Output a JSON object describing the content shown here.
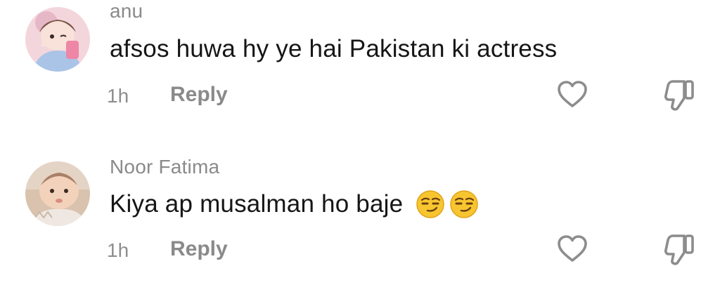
{
  "comments": [
    {
      "username": "anu",
      "text": "afsos huwa hy ye hai Pakistan ki actress",
      "time": "1h",
      "reply_label": "Reply",
      "emojis": []
    },
    {
      "username": "Noor Fatima",
      "text": "Kiya ap musalman ho baje",
      "time": "1h",
      "reply_label": "Reply",
      "emojis": [
        "smirking-face",
        "smirking-face"
      ]
    }
  ],
  "icons": {
    "like": "heart-icon",
    "dislike": "thumbs-down-icon"
  },
  "colors": {
    "text": "#161616",
    "muted": "#8a8a8a",
    "icon": "#8c8c8c",
    "emoji": "#f7c52f"
  }
}
